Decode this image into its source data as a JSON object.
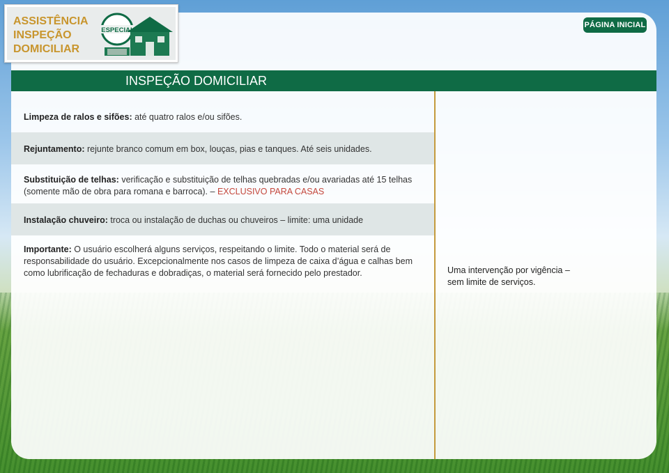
{
  "logo": {
    "line1": "ASSISTÊNCIA",
    "line2": "INSPEÇÃO",
    "line3": "DOMICILIAR",
    "badge": "ESPECIAL",
    "icon": "house-icon"
  },
  "nav": {
    "home_label": "PÁGINA INICIAL"
  },
  "page": {
    "title": "INSPEÇÃO DOMICILIAR"
  },
  "items": [
    {
      "label": "Limpeza de ralos e sifões:",
      "text": " até quatro ralos e/ou sifões."
    },
    {
      "label": "Rejuntamento:",
      "text": " rejunte branco comum em box, louças, pias e tanques. Até seis unidades."
    },
    {
      "label": "Substituição de telhas:",
      "text": " verificação e substituição de telhas quebradas e/ou avariadas até 15 telhas (somente mão de obra para romana e barroca). – ",
      "highlight": "EXCLUSIVO PARA CASAS"
    },
    {
      "label": "Instalação chuveiro:",
      "text": " troca ou instalação de duchas ou chuveiros – limite: uma unidade"
    },
    {
      "label": "Importante:",
      "text": " O usuário escolherá alguns serviços, respeitando o limite. Todo o material será de responsabilidade do usuário. Excepcionalmente nos casos de limpeza de caixa d’água e calhas bem como lubrificação de fechaduras e dobradiças, o material será fornecido pelo prestador."
    }
  ],
  "side_note": "Uma intervenção por vigência – sem limite de serviços.",
  "colors": {
    "primary_green": "#0f6b45",
    "accent_gold": "#c8952d",
    "highlight_red": "#c4473c",
    "divider": "#c49a3c"
  }
}
